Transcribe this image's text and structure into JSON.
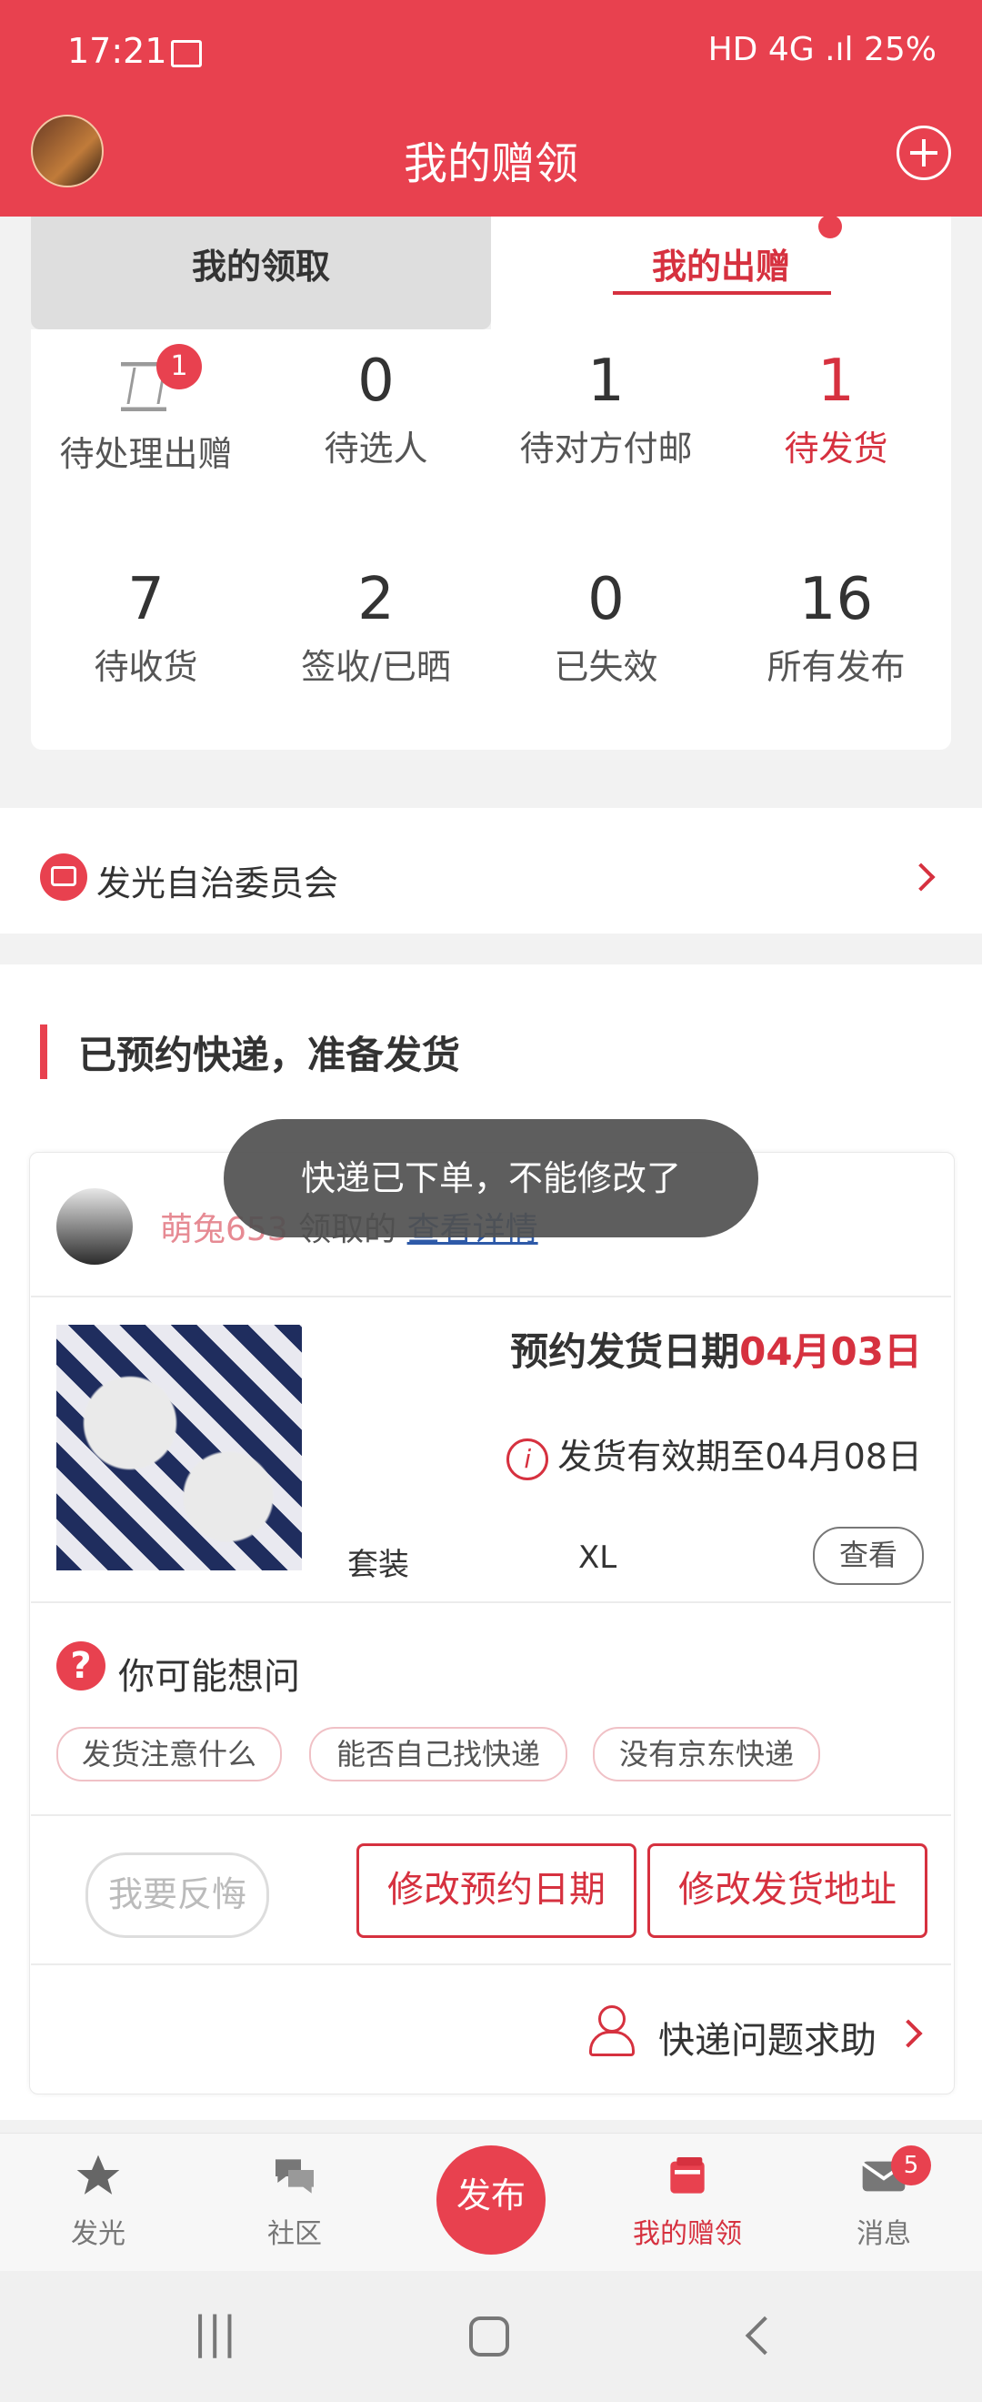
{
  "status_bar": {
    "time": "17:21",
    "right": "HD 4G .ıl 25%"
  },
  "header": {
    "title": "我的赠领"
  },
  "tabs": [
    {
      "label": "我的领取"
    },
    {
      "label": "我的出赠"
    }
  ],
  "stats": [
    {
      "label": "待处理出赠",
      "badge": "1"
    },
    {
      "value": "0",
      "label": "待选人"
    },
    {
      "value": "1",
      "label": "待对方付邮"
    },
    {
      "value": "1",
      "label": "待发货"
    },
    {
      "value": "7",
      "label": "待收货"
    },
    {
      "value": "2",
      "label": "签收/已晒"
    },
    {
      "value": "0",
      "label": "已失效"
    },
    {
      "value": "16",
      "label": "所有发布"
    }
  ],
  "org": {
    "label": "发光自治委员会"
  },
  "section": {
    "title": "已预约快递，准备发货"
  },
  "order": {
    "user_name": "萌兔653",
    "claim_text": " 领取的 ",
    "detail_link": "查看详情",
    "toast": "快递已下单，不能修改了",
    "date_label": "预约发货日期",
    "date_value": "04月03日",
    "valid_until": "发货有效期至04月08日",
    "attr_type": "套装",
    "attr_size": "XL",
    "view_btn": "查看",
    "faq_title": "你可能想问",
    "faq_chips": [
      "发货注意什么",
      "能否自己找快递",
      "没有京东快递"
    ],
    "btn_regret": "我要反悔",
    "btn_change_date": "修改预约日期",
    "btn_change_addr": "修改发货地址",
    "help": "快递问题求助"
  },
  "bottom_nav": [
    {
      "label": "发光"
    },
    {
      "label": "社区"
    },
    {
      "label": "发布"
    },
    {
      "label": "我的赠领"
    },
    {
      "label": "消息",
      "badge": "5"
    }
  ],
  "colors": {
    "brand": "#e8414f",
    "accent": "#d6313f"
  }
}
